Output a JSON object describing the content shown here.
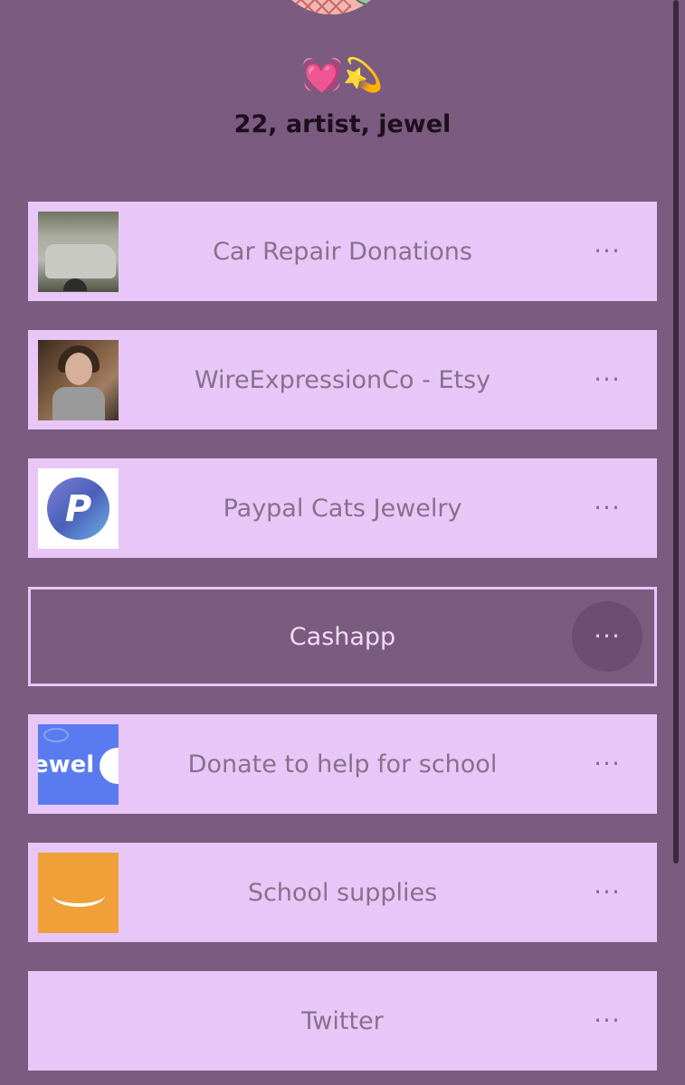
{
  "profile": {
    "emojis": "💓💫",
    "bio": "22, artist, jewel"
  },
  "links": [
    {
      "label": "Car Repair Donations",
      "thumbnail": "car-photo",
      "more_icon": "ellipsis"
    },
    {
      "label": "WireExpressionCo - Etsy",
      "thumbnail": "person-photo",
      "more_icon": "ellipsis"
    },
    {
      "label": "Paypal Cats Jewelry",
      "thumbnail": "paypal-logo",
      "more_icon": "ellipsis"
    },
    {
      "label": "Cashapp",
      "thumbnail": "none",
      "more_icon": "ellipsis",
      "state": "focused"
    },
    {
      "label": "Donate to help for school",
      "thumbnail": "jewel-banner",
      "thumb_text": "ewel",
      "more_icon": "ellipsis"
    },
    {
      "label": "School supplies",
      "thumbnail": "amazon-logo",
      "more_icon": "ellipsis"
    },
    {
      "label": "Twitter",
      "thumbnail": "none",
      "more_icon": "ellipsis"
    }
  ],
  "more_glyph": "···",
  "colors": {
    "background": "#7c5b80",
    "card": "#e8c6f8",
    "card_text": "#8a6f8a",
    "bio_text": "#1e0f1e"
  }
}
